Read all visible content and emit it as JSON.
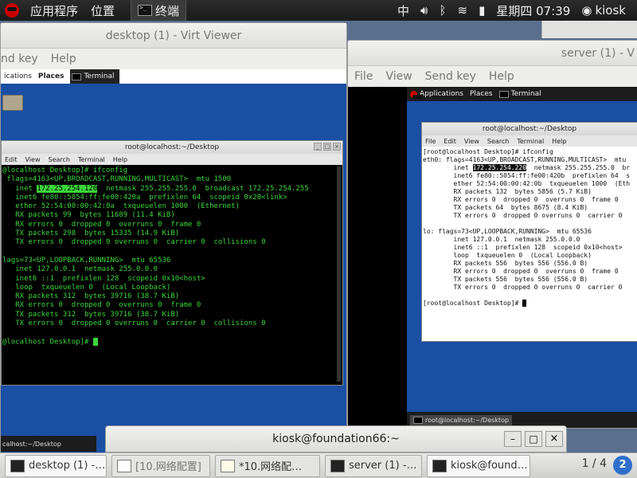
{
  "top_panel": {
    "applications": "应用程序",
    "places": "位置",
    "task_terminal": "终端",
    "input_method": "中",
    "clock": "星期四 07:39",
    "user": "kiosk"
  },
  "virt_viewer_desktop": {
    "title": "desktop (1) - Virt Viewer",
    "menu": [
      "nd key",
      "Help"
    ],
    "guest_panel": {
      "applications": "ications",
      "places": "Places",
      "terminal": "Terminal"
    },
    "terminal": {
      "title": "root@localhost:~/Desktop",
      "menu": [
        "Edit",
        "View",
        "Search",
        "Terminal",
        "Help"
      ],
      "lines": [
        "@localhost Desktop]# ifconfig",
        " flags=4163<UP,BROADCAST,RUNNING,MULTICAST>  mtu 1500",
        "   inet ",
        "   inet6 fe80::5054:ff:fe00:420a  prefixlen 64  scopeid 0x20<link>",
        "   ether 52:54:00:00:42:0a  txqueuelen 1000  (Ethernet)",
        "   RX packets 99  bytes 11689 (11.4 KiB)",
        "   RX errors 0  dropped 0  overruns 0  frame 0",
        "   TX packets 298  bytes 15335 (14.9 KiB)",
        "   TX errors 0  dropped 0 overruns 0  carrier 0  collisions 0",
        "",
        "lags=73<UP,LOOPBACK,RUNNING>  mtu 65536",
        "   inet 127.0.0.1  netmask 255.0.0.0",
        "   inet6 ::1  prefixlen 128  scopeid 0x10<host>",
        "   loop  txqueuelen 0  (Local Loopback)",
        "   RX packets 312  bytes 39716 (38.7 KiB)",
        "   RX errors 0  dropped 0  overruns 0  frame 0",
        "   TX packets 312  bytes 39716 (38.7 KiB)",
        "   TX errors 0  dropped 0 overruns 0  carrier 0  collisions 0",
        "",
        "@localhost Desktop]# "
      ],
      "inet_highlight": "172.25.254.120",
      "inet_rest": "  netmask 255.255.255.0  broadcast 172.25.254.255"
    },
    "guest_taskbar": "calhost:~/Desktop"
  },
  "virt_viewer_server": {
    "title": "server (1) - V",
    "menu": [
      "File",
      "View",
      "Send key",
      "Help"
    ],
    "guest_panel": {
      "applications": "Applications",
      "places": "Places",
      "terminal": "Terminal"
    },
    "terminal": {
      "title": "root@localhost:~/Desktop",
      "menu": [
        "File",
        "Edit",
        "View",
        "Search",
        "Terminal",
        "Help"
      ],
      "lines": [
        "[root@localhost Desktop]# ifconfig",
        "eth0: flags=4163<UP,BROADCAST,RUNNING,MULTICAST>  mtu",
        "        inet ",
        "        inet6 fe80::5054:ff:fe00:420b  prefixlen 64  s",
        "        ether 52:54:00:00:42:0b  txqueuelen 1000  (Eth",
        "        RX packets 132  bytes 5856 (5.7 KiB)",
        "        RX errors 0  dropped 0  overruns 0  frame 0",
        "        TX packets 64  bytes 8675 (8.4 KiB)",
        "        TX errors 0  dropped 0 overruns 0  carrier 0",
        "",
        "lo: flags=73<UP,LOOPBACK,RUNNING>  mtu 65536",
        "        inet 127.0.0.1  netmask 255.0.0.0",
        "        inet6 ::1  prefixlen 128  scopeid 0x10<host>",
        "        loop  txqueuelen 0  (Local Loopback)",
        "        RX packets 556  bytes 556 (556.0 B)",
        "        RX errors 0  dropped 0  overruns 0  frame 0",
        "        TX packets 556  bytes 556 (556.0 B)",
        "        TX errors 0  dropped 0 overruns 0  carrier 0",
        "",
        "[root@localhost Desktop]# "
      ],
      "inet_highlight": "172.25.254.220",
      "inet_rest": "  netmask 255.255.255.0  br"
    },
    "guest_taskbar": "root@localhost:~/Desktop"
  },
  "host_terminal": {
    "title": "kiosk@foundation66:~"
  },
  "taskbar": {
    "items": [
      "desktop (1) -…",
      "[10.网络配置]",
      "*10.网络配…",
      "server (1) -…",
      "kiosk@found…"
    ],
    "pager": "1 / 4"
  }
}
